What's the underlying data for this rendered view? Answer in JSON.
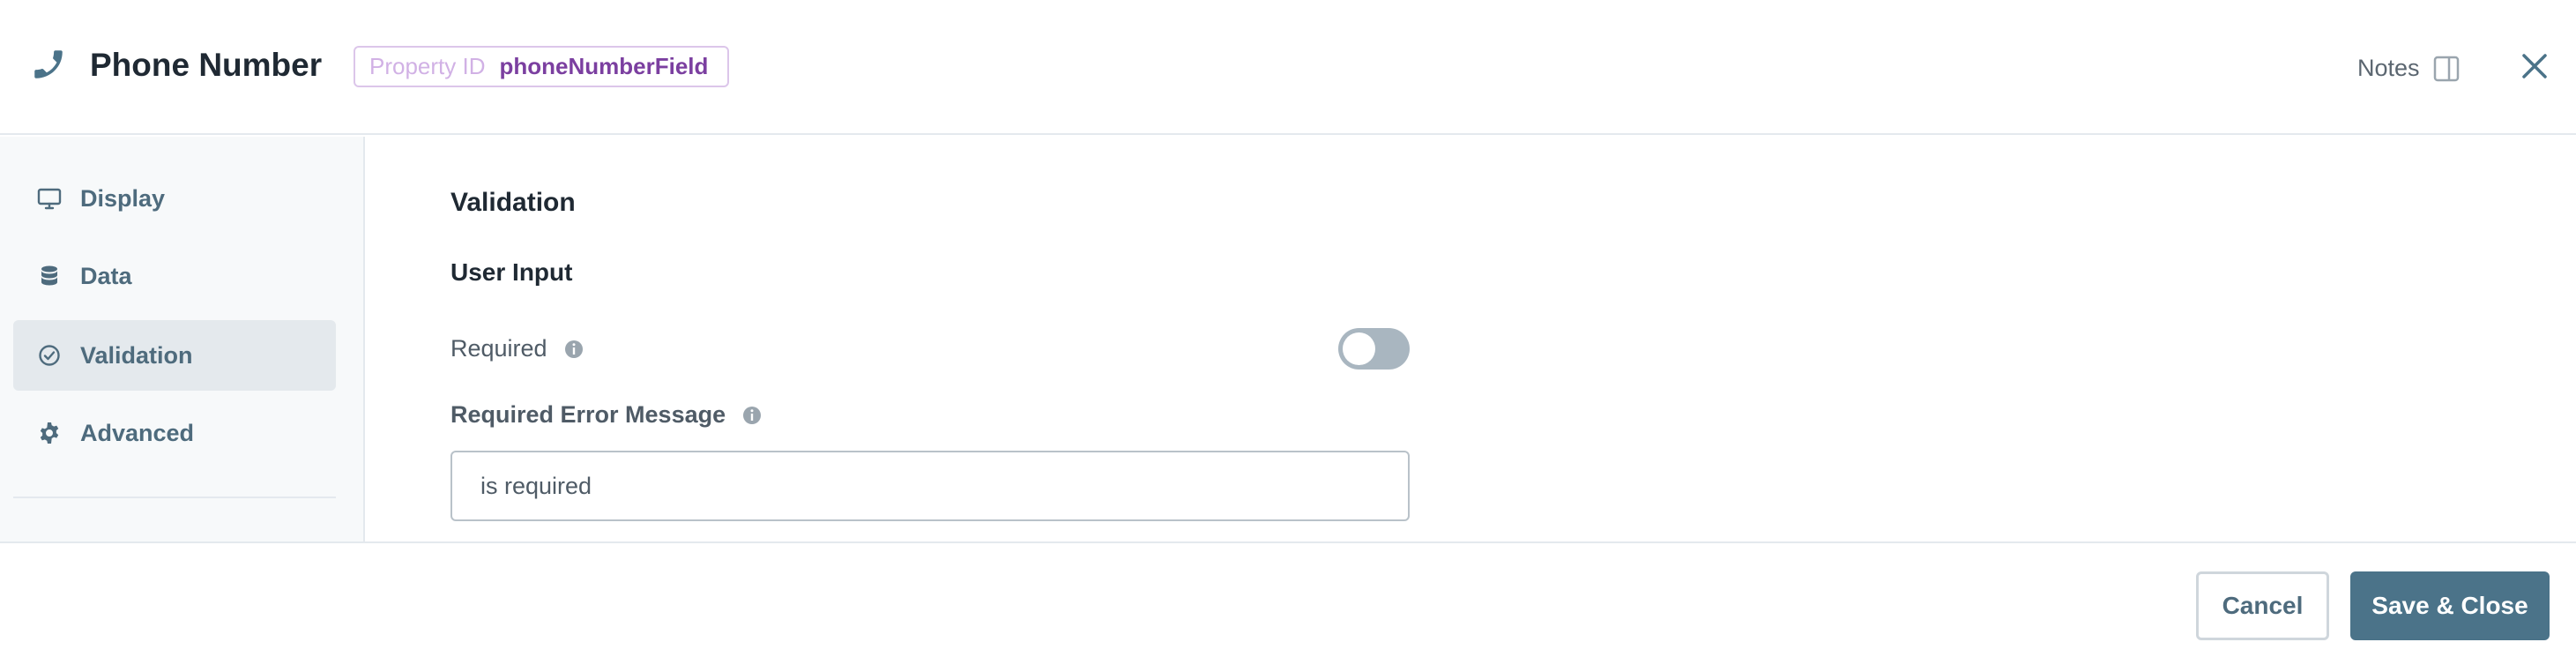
{
  "header": {
    "icon": "phone-icon",
    "title": "Phone Number",
    "property_id_label": "Property ID",
    "property_id_value": "phoneNumberField",
    "notes_label": "Notes"
  },
  "sidebar": {
    "items": [
      {
        "label": "Display",
        "icon": "monitor-icon",
        "active": false
      },
      {
        "label": "Data",
        "icon": "database-icon",
        "active": false
      },
      {
        "label": "Validation",
        "icon": "check-circle-icon",
        "active": true
      },
      {
        "label": "Advanced",
        "icon": "gear-icon",
        "active": false
      }
    ]
  },
  "main": {
    "section_title": "Validation",
    "subsection_title": "User Input",
    "required_label": "Required",
    "required_enabled": false,
    "error_message_label": "Required Error Message",
    "error_message_value": "is required"
  },
  "footer": {
    "cancel_label": "Cancel",
    "save_label": "Save & Close"
  },
  "colors": {
    "accent": "#4b7389",
    "badge_text": "#7b3fa0",
    "badge_border": "#dcc6ea",
    "toggle_off": "#a9b6c0"
  }
}
